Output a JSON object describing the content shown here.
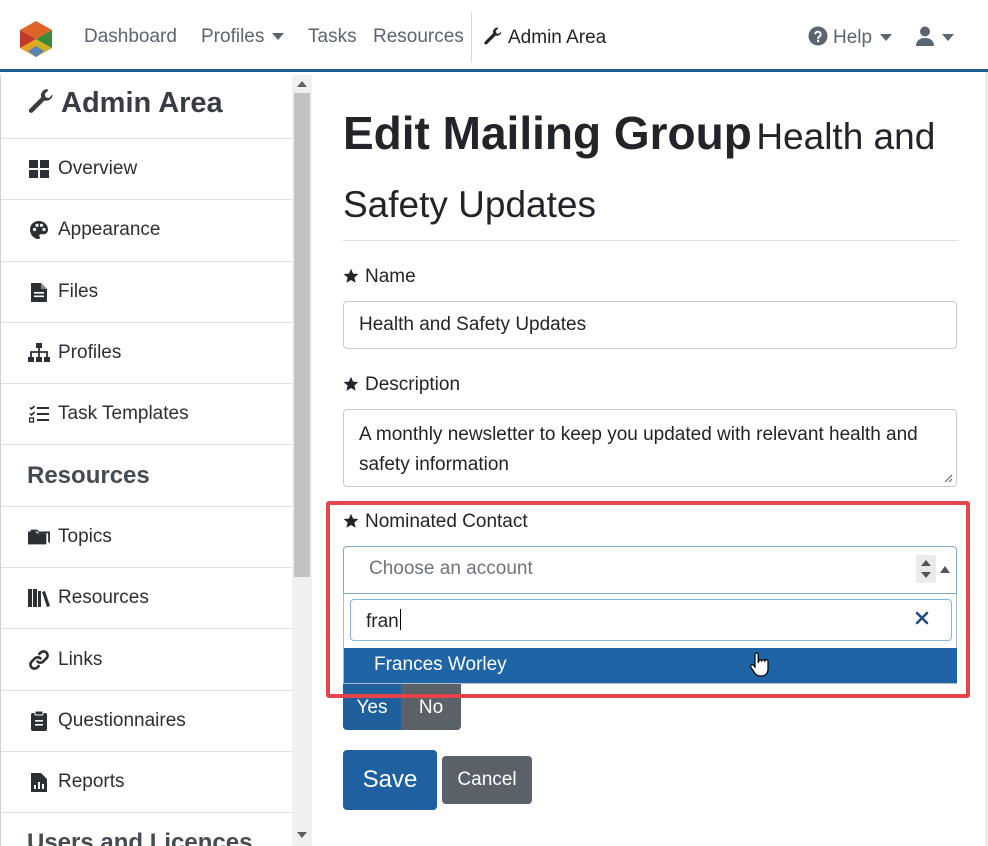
{
  "navbar": {
    "items": [
      {
        "label": "Dashboard"
      },
      {
        "label": "Profiles"
      },
      {
        "label": "Tasks"
      },
      {
        "label": "Resources"
      }
    ],
    "admin_label": "Admin Area",
    "help_label": "Help",
    "accent": "#1f5f8f"
  },
  "sidebar": {
    "title": "Admin Area",
    "items": [
      {
        "label": "Overview",
        "icon": "th-large-icon"
      },
      {
        "label": "Appearance",
        "icon": "palette-icon"
      },
      {
        "label": "Files",
        "icon": "file-icon"
      },
      {
        "label": "Profiles",
        "icon": "sitemap-icon"
      },
      {
        "label": "Task Templates",
        "icon": "tasks-icon"
      }
    ],
    "section_resources": "Resources",
    "resource_items": [
      {
        "label": "Topics",
        "icon": "folder-icon"
      },
      {
        "label": "Resources",
        "icon": "books-icon"
      },
      {
        "label": "Links",
        "icon": "link-icon"
      },
      {
        "label": "Questionnaires",
        "icon": "clipboard-icon"
      },
      {
        "label": "Reports",
        "icon": "report-icon"
      }
    ],
    "section_users": "Users and Licences"
  },
  "main": {
    "title": "Edit Mailing Group",
    "subtitle": "Health and Safety Updates",
    "name_label": "Name",
    "name_value": "Health and Safety Updates",
    "description_label": "Description",
    "description_value": "A monthly newsletter to keep you updated with relevant health and safety information",
    "contact_label": "Nominated Contact",
    "contact_placeholder": "Choose an account",
    "search_value": "fran",
    "option": "Frances Worley",
    "toggle_yes": "Yes",
    "toggle_no": "No",
    "save_label": "Save",
    "cancel_label": "Cancel"
  },
  "colors": {
    "primary": "#1f60a0",
    "secondary": "#5a6168",
    "highlight": "#e5454b"
  }
}
